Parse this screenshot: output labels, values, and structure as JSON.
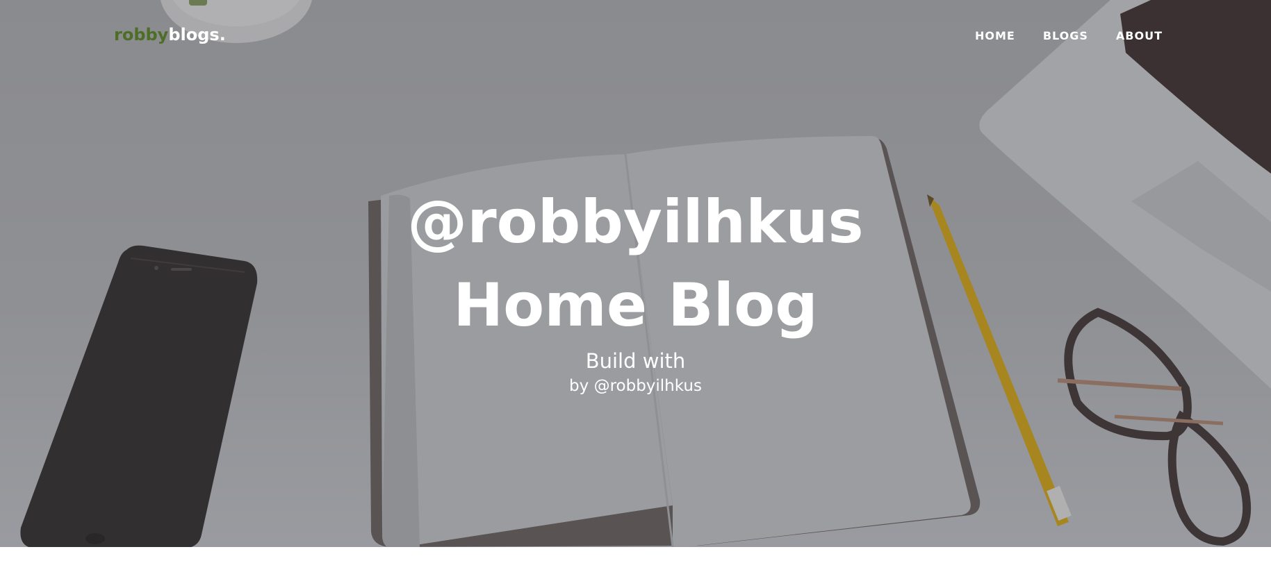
{
  "nav": {
    "brand_accent": "robby",
    "brand_rest": "blogs.",
    "links": [
      {
        "label": "HOME"
      },
      {
        "label": "BLOGS"
      },
      {
        "label": "ABOUT"
      }
    ]
  },
  "hero": {
    "title_line1": "@robbyilhkus",
    "title_line2": "Home Blog",
    "subheading": "Build with",
    "byline": "by @robbyilhkus"
  },
  "colors": {
    "brand_accent": "#4e6e27",
    "text": "#ffffff",
    "overlay": "#8d8e92"
  },
  "icons": [
    "smartphone-icon",
    "notebook-icon",
    "pencil-icon",
    "laptop-icon",
    "eyeglasses-icon",
    "coffee-cup-icon"
  ]
}
